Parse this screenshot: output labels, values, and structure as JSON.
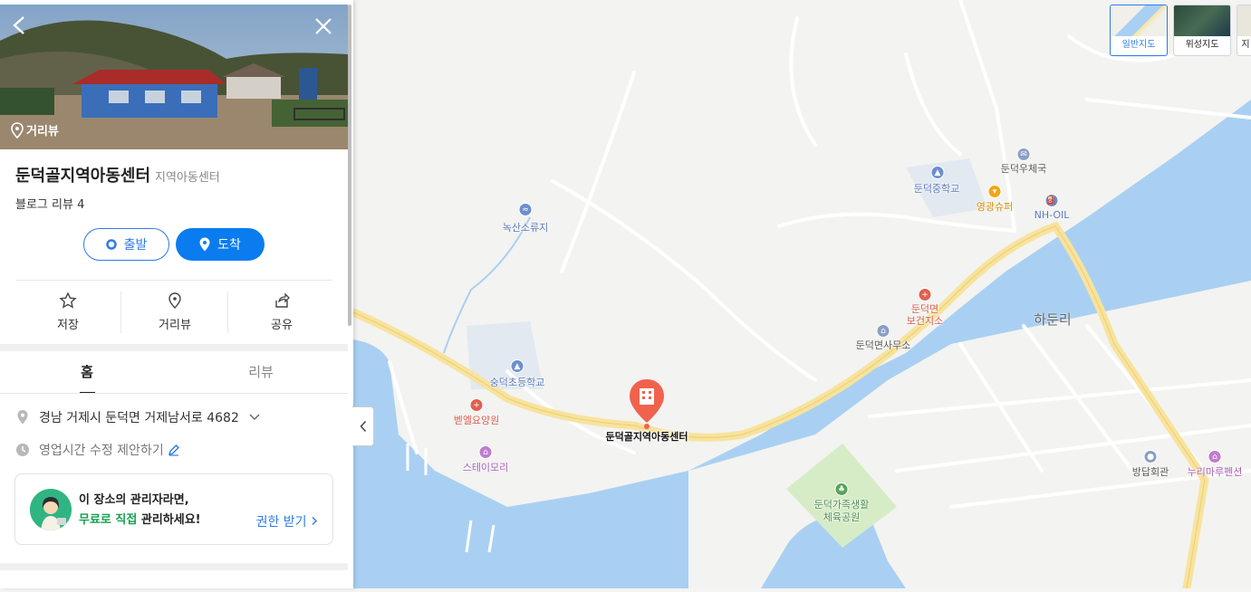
{
  "panel": {
    "street_view_label": "거리뷰",
    "place_name": "둔덕골지역아동센터",
    "place_category": "지역아동센터",
    "blog_review": "블로그 리뷰 4",
    "start_label": "출발",
    "arrive_label": "도착",
    "actions": [
      {
        "label": "저장",
        "icon": "star-icon"
      },
      {
        "label": "거리뷰",
        "icon": "location-pin-icon"
      },
      {
        "label": "공유",
        "icon": "share-icon"
      }
    ],
    "tabs": [
      {
        "label": "홈",
        "active": true
      },
      {
        "label": "리뷰",
        "active": false
      }
    ],
    "address": "경남 거제시 둔덕면 거제남서로 4682",
    "hours_suggest": "영업시간 수정 제안하기",
    "owner_line1": "이 장소의 관리자라면,",
    "owner_line2_green": "무료로 직접",
    "owner_line2_rest": " 관리하세요!",
    "owner_link": "권한 받기"
  },
  "map": {
    "map_types": [
      {
        "label": "일반지도",
        "active": true
      },
      {
        "label": "위성지도",
        "active": false
      },
      {
        "label": "지",
        "active": false
      }
    ],
    "selected_place": "둔덕골지역아동센터",
    "region": "하둔리",
    "pois": {
      "post_office": "둔덕우체국",
      "middle_school": "둔덕중학교",
      "supermarket": "영광슈퍼",
      "gas_station": "NH-OIL",
      "reservoir": "녹산소류지",
      "health_center_1": "둔덕면",
      "health_center_2": "보건지소",
      "township_office": "둔덕면사무소",
      "elementary_school": "숭덕초등학교",
      "nursing_home": "벧엘요양원",
      "stay": "스테이모리",
      "park_1": "둔덕가족생활",
      "park_2": "체육공원",
      "hall": "방답회관",
      "pension": "누리마루펜션"
    }
  },
  "colors": {
    "accent": "#0a7cf0",
    "water": "#a9d0f2",
    "road": "#f8e39d",
    "green": "#15a04f"
  }
}
